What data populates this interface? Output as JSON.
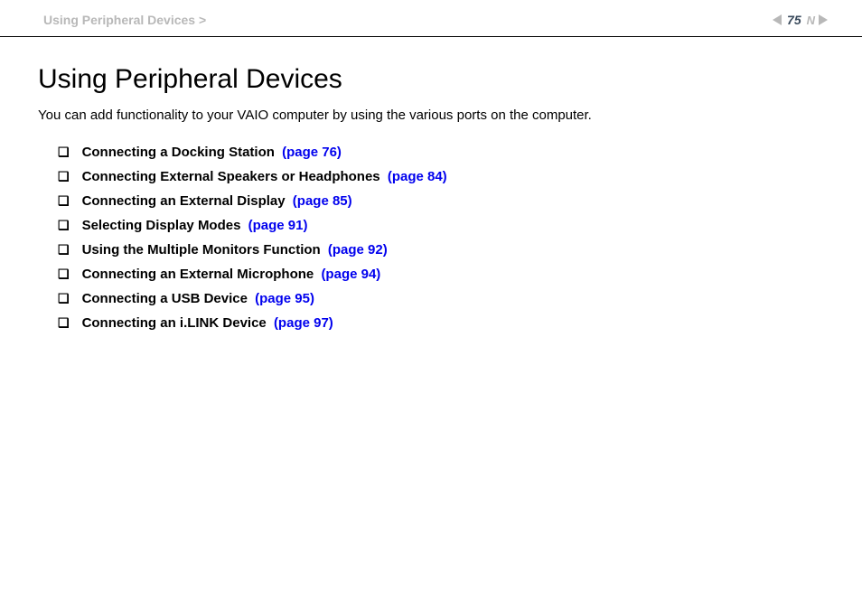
{
  "header": {
    "breadcrumb": "Using Peripheral Devices >",
    "page_number": "75",
    "n_label": "N"
  },
  "main": {
    "title": "Using Peripheral Devices",
    "intro": "You can add functionality to your VAIO computer by using the various ports on the computer.",
    "toc": [
      {
        "label": "Connecting a Docking Station",
        "page_ref": "(page 76)"
      },
      {
        "label": "Connecting External Speakers or Headphones",
        "page_ref": "(page 84)"
      },
      {
        "label": "Connecting an External Display",
        "page_ref": "(page 85)"
      },
      {
        "label": "Selecting Display Modes",
        "page_ref": "(page 91)"
      },
      {
        "label": "Using the Multiple Monitors Function",
        "page_ref": "(page 92)"
      },
      {
        "label": "Connecting an External Microphone",
        "page_ref": "(page 94)"
      },
      {
        "label": "Connecting a USB Device",
        "page_ref": "(page 95)"
      },
      {
        "label": "Connecting an i.LINK Device",
        "page_ref": "(page 97)"
      }
    ]
  },
  "bullet_glyph": "❏"
}
